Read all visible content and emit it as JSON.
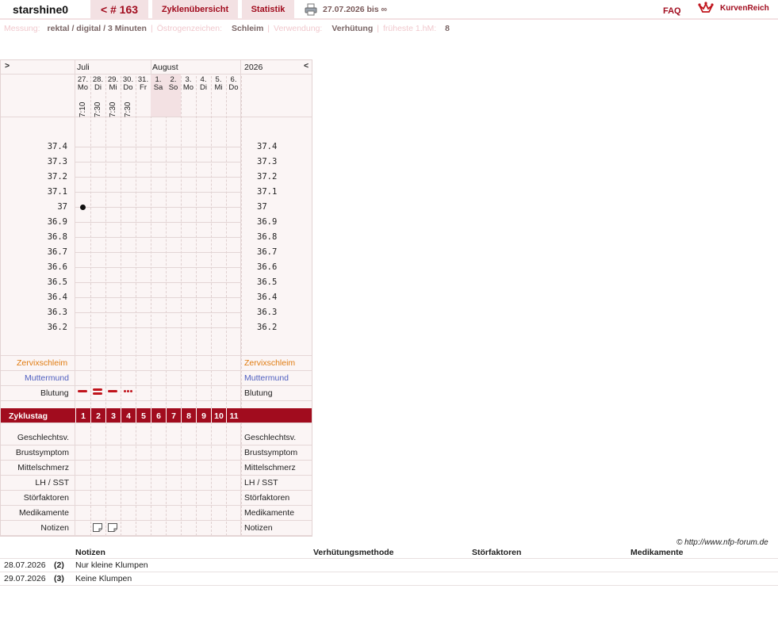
{
  "header": {
    "username": "starshine0",
    "cycle_nav": "< # 163",
    "tab_overview": "Zyklenübersicht",
    "tab_stats": "Statistik",
    "date_range": "27.07.2026 bis ∞",
    "faq": "FAQ",
    "brand": "KurvenReich"
  },
  "meta": [
    {
      "key": "Messung:",
      "value": "rektal / digital / 3 Minuten"
    },
    {
      "key": "Östrogenzeichen:",
      "value": "Schleim"
    },
    {
      "key": "Verwendung:",
      "value": "Verhütung"
    },
    {
      "key": "früheste 1.hM:",
      "value": "8"
    }
  ],
  "chart": {
    "nav_prev": ">",
    "nav_next": "<",
    "month_1": "Juli",
    "month_2": "August",
    "year": "2026",
    "days": [
      {
        "d": "27.",
        "w": "Mo",
        "time": "7:10",
        "weekend": false
      },
      {
        "d": "28.",
        "w": "Di",
        "time": "7:30",
        "weekend": false
      },
      {
        "d": "29.",
        "w": "Mi",
        "time": "7:30",
        "weekend": false
      },
      {
        "d": "30.",
        "w": "Do",
        "time": "7:30",
        "weekend": false
      },
      {
        "d": "31.",
        "w": "Fr",
        "time": "",
        "weekend": false
      },
      {
        "d": "1.",
        "w": "Sa",
        "time": "",
        "weekend": true
      },
      {
        "d": "2.",
        "w": "So",
        "time": "",
        "weekend": true
      },
      {
        "d": "3.",
        "w": "Mo",
        "time": "",
        "weekend": false
      },
      {
        "d": "4.",
        "w": "Di",
        "time": "",
        "weekend": false
      },
      {
        "d": "5.",
        "w": "Mi",
        "time": "",
        "weekend": false
      },
      {
        "d": "6.",
        "w": "Do",
        "time": "",
        "weekend": false
      }
    ],
    "temps": [
      "37.4",
      "37.3",
      "37.2",
      "37.1",
      "37",
      "36.9",
      "36.8",
      "36.7",
      "36.6",
      "36.5",
      "36.4",
      "36.3",
      "36.2"
    ],
    "temperature_points": [
      {
        "day": 1,
        "value": 37.0
      }
    ],
    "bleeding": [
      {
        "day": 1,
        "type": "dash"
      },
      {
        "day": 2,
        "type": "double"
      },
      {
        "day": 3,
        "type": "dash"
      },
      {
        "day": 4,
        "type": "dots"
      }
    ],
    "notes_days": [
      2,
      3
    ],
    "rows_top": {
      "zervix": "Zervixschleim",
      "muttermund": "Muttermund",
      "blutung": "Blutung"
    },
    "cycle_label": "Zyklustag",
    "cycle_days": [
      "1",
      "2",
      "3",
      "4",
      "5",
      "6",
      "7",
      "8",
      "9",
      "10",
      "11"
    ],
    "rows_bottom": [
      "Geschlechtsv.",
      "Brustsymptom",
      "Mittelschmerz",
      "LH / SST",
      "Störfaktoren",
      "Medikamente",
      "Notizen"
    ]
  },
  "copyright": "© http://www.nfp-forum.de",
  "notes_table": {
    "headers": [
      "Notizen",
      "Verhütungsmethode",
      "Störfaktoren",
      "Medikamente"
    ],
    "rows": [
      {
        "date": "28.07.2026",
        "day": "(2)",
        "note": "Nur kleine Klumpen"
      },
      {
        "date": "29.07.2026",
        "day": "(3)",
        "note": "Keine Klumpen"
      }
    ]
  }
}
